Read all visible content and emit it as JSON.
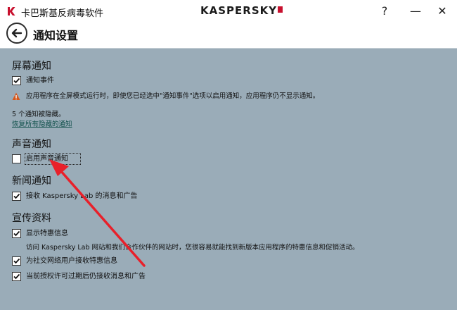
{
  "app": {
    "title": "卡巴斯基反病毒软件",
    "brand": "KASPERSKY",
    "help_label": "?",
    "minimize_label": "—",
    "close_label": "✕"
  },
  "page": {
    "title": "通知设置",
    "back_icon": "arrow-left-icon"
  },
  "sections": {
    "screen": {
      "title": "屏幕通知",
      "notify_events": {
        "label": "通知事件",
        "checked": true
      },
      "warning": "应用程序在全屏模式运行时，即使您已经选中\"通知事件\"选项以启用通知，应用程序仍不显示通知。",
      "hidden_count": "5 个通知被隐藏。",
      "restore_link": "恢复所有隐藏的通知"
    },
    "sound": {
      "title": "声音通知",
      "enable_sound": {
        "label": "启用声音通知",
        "checked": false
      }
    },
    "news": {
      "title": "新闻通知",
      "receive_news": {
        "label": "接收 Kaspersky Lab 的消息和广告",
        "checked": true
      }
    },
    "promo": {
      "title": "宣传资料",
      "show_offers": {
        "label": "显示特惠信息",
        "checked": true
      },
      "offers_desc": "访问 Kaspersky Lab 网站和我们合作伙伴的网站时，您很容易就能找到新版本应用程序的特惠信息和促销活动。",
      "social_offers": {
        "label": "为社交网络用户接收特惠信息",
        "checked": true
      },
      "after_license": {
        "label": "当前授权许可过期后仍接收消息和广告",
        "checked": true
      }
    }
  },
  "colors": {
    "background": "#9aacb8",
    "annotation_arrow": "#e8202a",
    "brand_badge": "#c8102e",
    "link": "#0f4f4a"
  }
}
